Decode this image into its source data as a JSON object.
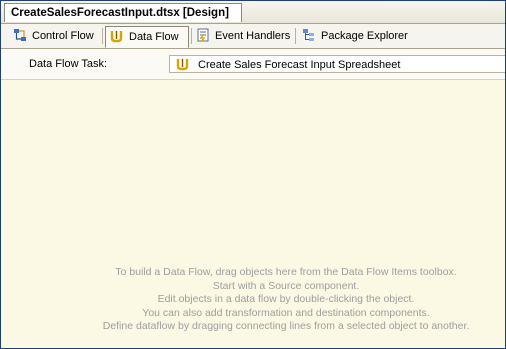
{
  "document_tab": {
    "title": "CreateSalesForecastInput.dtsx [Design]"
  },
  "designer_tabs": [
    {
      "label": "Control Flow",
      "icon": "control-flow-icon",
      "active": false
    },
    {
      "label": "Data Flow",
      "icon": "data-flow-icon",
      "active": true
    },
    {
      "label": "Event Handlers",
      "icon": "event-handlers-icon",
      "active": false
    },
    {
      "label": "Package Explorer",
      "icon": "package-explorer-icon",
      "active": false
    }
  ],
  "task": {
    "label": "Data Flow Task:",
    "selected": "Create Sales Forecast Input Spreadsheet",
    "icon": "data-flow-task-icon"
  },
  "surface": {
    "hint_lines": [
      "To build a Data Flow, drag objects here from the Data Flow Items toolbox.",
      "Start with a Source component.",
      "Edit objects in a data flow by double-clicking the object.",
      "You can also add transformation and destination components.",
      "Define dataflow by dragging connecting lines from a selected object to another."
    ]
  },
  "colors": {
    "surface": "#fbf8e4",
    "hint_text": "#9e9e9e",
    "chrome": "#ece9d8"
  }
}
